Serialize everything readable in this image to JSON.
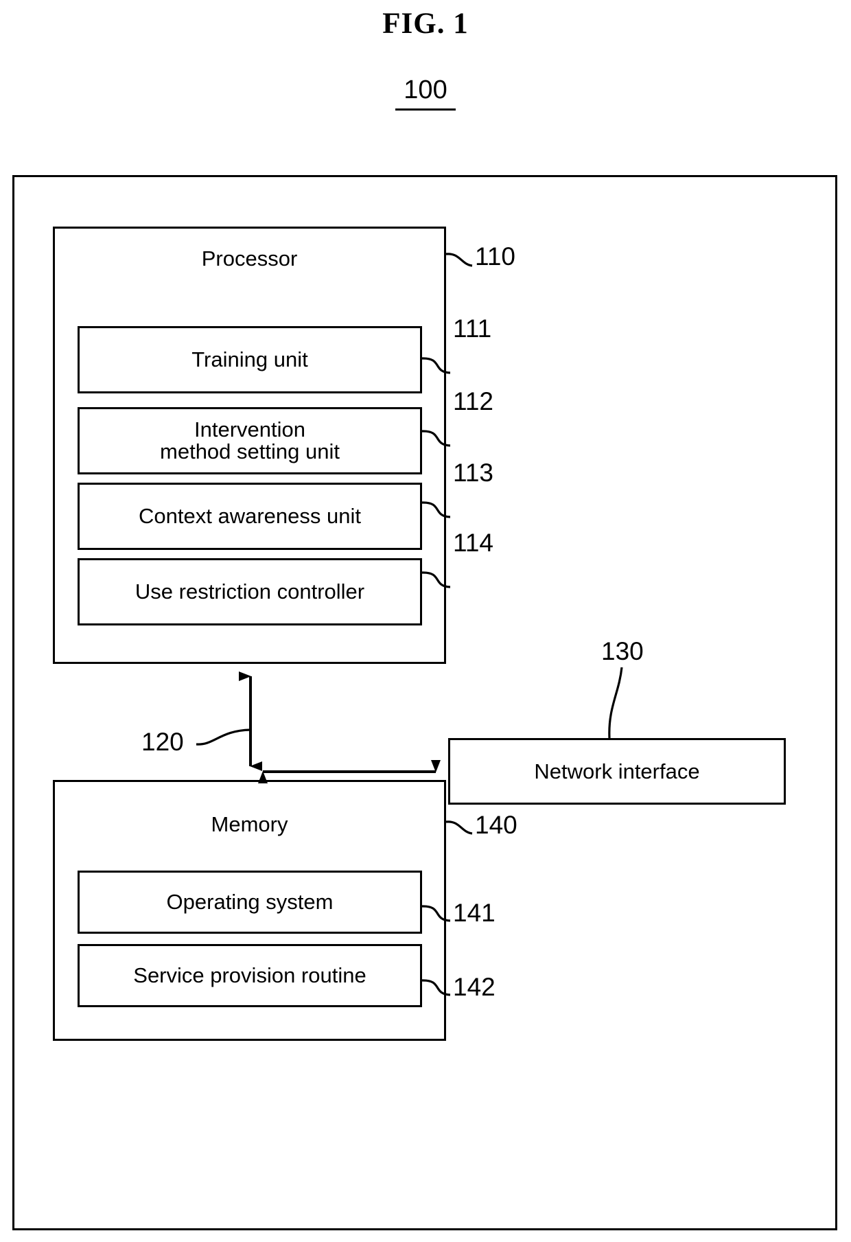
{
  "figure": {
    "title": "FIG. 1",
    "number": "100"
  },
  "outer_device": {
    "ref": "100"
  },
  "processor": {
    "label": "Processor",
    "ref": "110",
    "units": [
      {
        "label": "Training unit",
        "ref": "111"
      },
      {
        "label": "Intervention\nmethod setting unit",
        "ref": "112"
      },
      {
        "label": "Context awareness unit",
        "ref": "113"
      },
      {
        "label": "Use restriction controller",
        "ref": "114"
      }
    ]
  },
  "bus": {
    "ref": "120"
  },
  "network_interface": {
    "label": "Network interface",
    "ref": "130"
  },
  "memory": {
    "label": "Memory",
    "ref": "140",
    "items": [
      {
        "label": "Operating system",
        "ref": "141"
      },
      {
        "label": "Service provision routine",
        "ref": "142"
      }
    ]
  },
  "colors": {
    "stroke": "#000000",
    "background": "#ffffff"
  }
}
